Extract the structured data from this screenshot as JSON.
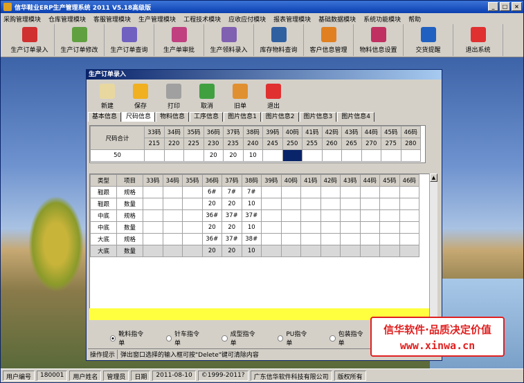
{
  "window": {
    "title": "信华鞋业ERP生产管理系统   2011   V5.18高级版"
  },
  "menu": [
    "采购管理模块",
    "仓库管理模块",
    "客服管理模块",
    "生产管理模块",
    "工程技术模块",
    "应收应付模块",
    "报表管理模块",
    "基础数据模块",
    "系统功能模块",
    "帮助"
  ],
  "toolbar": [
    {
      "label": "生产订单录入",
      "icon": "pdf-doc-icon",
      "color": "#d03030"
    },
    {
      "label": "生产订单修改",
      "icon": "edit-doc-icon",
      "color": "#60a040"
    },
    {
      "label": "生产订单查询",
      "icon": "query-doc-icon",
      "color": "#7060c0"
    },
    {
      "label": "生产单审批",
      "icon": "approve-doc-icon",
      "color": "#c04080"
    },
    {
      "label": "生产领料录入",
      "icon": "material-doc-icon",
      "color": "#8060b0"
    },
    {
      "label": "库存物料查询",
      "icon": "inventory-icon",
      "color": "#3060a0"
    },
    {
      "label": "客户信息管理",
      "icon": "customer-icon",
      "color": "#e08020"
    },
    {
      "label": "物料信息设置",
      "icon": "material-settings-icon",
      "color": "#c03060"
    },
    {
      "label": "交货提醒",
      "icon": "delivery-reminder-icon",
      "color": "#2060c0"
    },
    {
      "label": "退出系统",
      "icon": "exit-icon",
      "color": "#e03030"
    }
  ],
  "child": {
    "title": "生产订单录入",
    "buttons": [
      {
        "label": "新建",
        "icon": "new-icon",
        "color": "#e8d8a0"
      },
      {
        "label": "保存",
        "icon": "save-icon",
        "color": "#f0b020"
      },
      {
        "label": "打印",
        "icon": "print-icon",
        "color": "#a0a0a0"
      },
      {
        "label": "取消",
        "icon": "cancel-icon",
        "color": "#40a040"
      },
      {
        "label": "旧单",
        "icon": "old-order-icon",
        "color": "#e09030"
      },
      {
        "label": "退出",
        "icon": "exit-icon",
        "color": "#e03030"
      }
    ],
    "tabs": [
      "基本信息",
      "尺码信息",
      "物料信息",
      "工序信息",
      "图片信息1",
      "图片信息2",
      "图片信息3",
      "图片信息4"
    ],
    "active_tab": 1,
    "size_header": {
      "label": "尺码合计",
      "codes": [
        "33码",
        "34码",
        "35码",
        "36码",
        "37码",
        "38码",
        "39码",
        "40码",
        "41码",
        "42码",
        "43码",
        "44码",
        "45码",
        "46码"
      ],
      "sizes": [
        "215",
        "220",
        "225",
        "230",
        "235",
        "240",
        "245",
        "250",
        "255",
        "260",
        "265",
        "270",
        "275",
        "280"
      ]
    },
    "size_row": {
      "total": "50",
      "values": [
        "",
        "",
        "",
        "20",
        "20",
        "10",
        "",
        "",
        "",
        "",
        "",
        "",
        "",
        ""
      ]
    },
    "detail_headers": [
      "类型",
      "项目",
      "33码",
      "34码",
      "35码",
      "36码",
      "37码",
      "38码",
      "39码",
      "40码",
      "41码",
      "42码",
      "43码",
      "44码",
      "45码",
      "46码"
    ],
    "detail_rows": [
      [
        "鞋跟",
        "规格",
        "",
        "",
        "",
        "6#",
        "7#",
        "7#",
        "",
        "",
        "",
        "",
        "",
        "",
        "",
        ""
      ],
      [
        "鞋跟",
        "数量",
        "",
        "",
        "",
        "20",
        "20",
        "10",
        "",
        "",
        "",
        "",
        "",
        "",
        "",
        ""
      ],
      [
        "中底",
        "规格",
        "",
        "",
        "",
        "36#",
        "37#",
        "37#",
        "",
        "",
        "",
        "",
        "",
        "",
        "",
        ""
      ],
      [
        "中底",
        "数量",
        "",
        "",
        "",
        "20",
        "20",
        "10",
        "",
        "",
        "",
        "",
        "",
        "",
        "",
        ""
      ],
      [
        "大底",
        "规格",
        "",
        "",
        "",
        "36#",
        "37#",
        "38#",
        "",
        "",
        "",
        "",
        "",
        "",
        "",
        ""
      ],
      [
        "大底",
        "数量",
        "",
        "",
        "",
        "20",
        "20",
        "10",
        "",
        "",
        "",
        "",
        "",
        "",
        "",
        ""
      ]
    ],
    "radios": [
      "靴料指令单",
      "针车指令单",
      "成型指令单",
      "PU指令单",
      "包装指令单"
    ],
    "radio_selected": 0,
    "hint_label": "操作提示",
    "hint_text": "弹出窗口选择的输入框可按\"Delete\"键可清除内容"
  },
  "status": [
    {
      "label": "用户编号"
    },
    {
      "label": "180001"
    },
    {
      "label": "用户姓名"
    },
    {
      "label": "管理员"
    },
    {
      "label": "日期"
    },
    {
      "label": "2011-08-10"
    },
    {
      "label": "©1999-2011?"
    },
    {
      "label": "广东信华软件科技有限公司"
    },
    {
      "label": "版权所有"
    }
  ],
  "promo": {
    "line1": "信华软件·品质决定价值",
    "line2": "www.xinwa.cn"
  }
}
